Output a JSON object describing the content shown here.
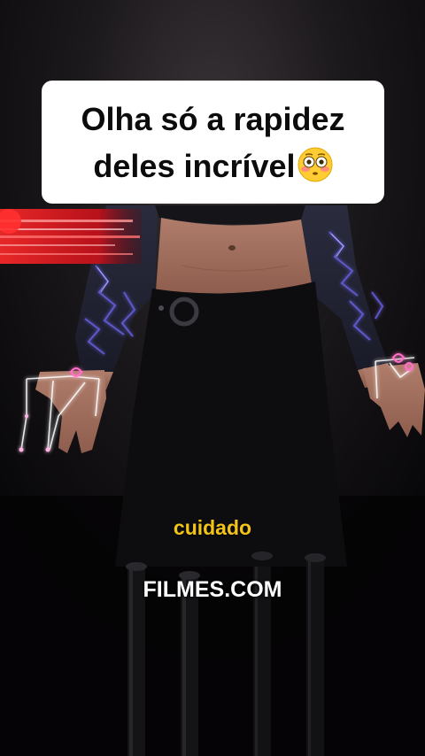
{
  "caption": {
    "text": "Olha só a rapidez\ndeles incrível",
    "emoji": "flushed-face-emoji"
  },
  "subtitle": {
    "yellow_text": "cuidado",
    "white_text": "FILMES.COM"
  },
  "colors": {
    "caption_bg": "#ffffff",
    "caption_text": "#0c0c0c",
    "subtitle_yellow": "#f2c418",
    "subtitle_white": "#ffffff",
    "glitch_red": "#e0161b",
    "lightning_blue": "#5b54d8",
    "glow_pink": "#ff6fc6"
  }
}
